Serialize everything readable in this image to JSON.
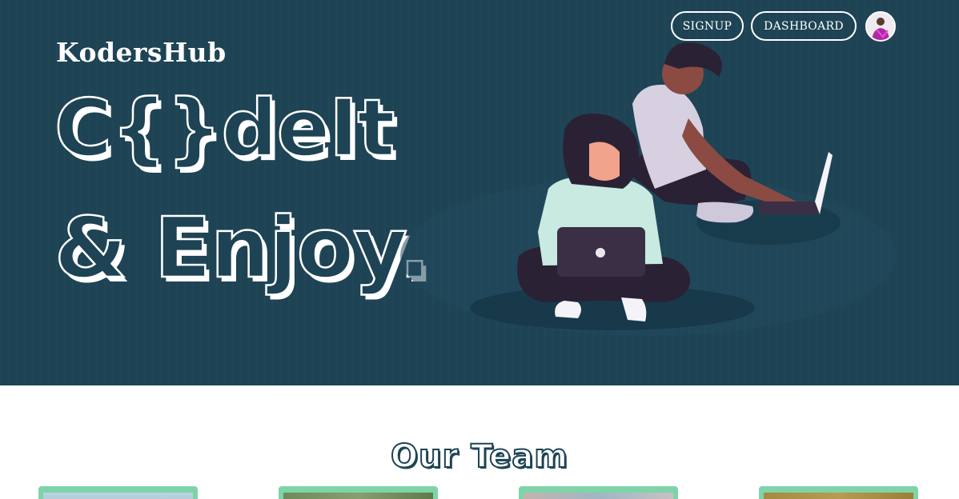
{
  "header": {
    "brand": "KodersHub",
    "headline_line1": "C{}deIt",
    "headline_line2": "& Enjoy."
  },
  "nav": {
    "signup_label": "SIGNUP",
    "dashboard_label": "DASHBOARD",
    "avatar_icon": "user-avatar"
  },
  "team": {
    "title": "Our Team",
    "members": [
      {
        "photo": "member-photo"
      },
      {
        "photo": "member-photo"
      },
      {
        "photo": "member-photo"
      },
      {
        "photo": "member-photo"
      }
    ]
  },
  "colors": {
    "hero_background": "#1d4354",
    "card_accent": "#7ed4a8",
    "text_light": "#ffffff"
  }
}
